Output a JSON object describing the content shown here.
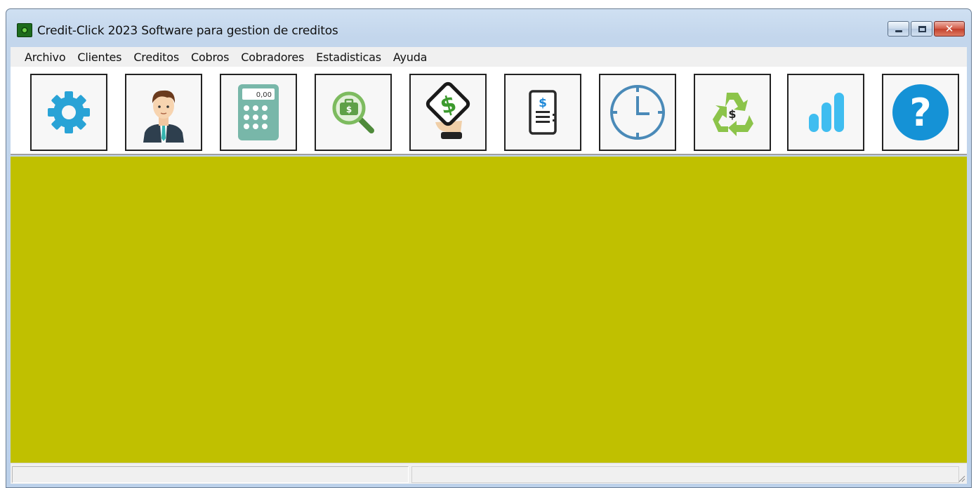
{
  "window": {
    "title": "Credit-Click 2023 Software para gestion de creditos"
  },
  "menu": [
    "Archivo",
    "Clientes",
    "Creditos",
    "Cobros",
    "Cobradores",
    "Estadisticas",
    "Ayuda"
  ],
  "toolbar": {
    "calculator_display": "0,00",
    "buttons": [
      {
        "icon": "gear-icon"
      },
      {
        "icon": "person-icon"
      },
      {
        "icon": "calculator-icon"
      },
      {
        "icon": "money-search-icon"
      },
      {
        "icon": "hand-phone-dollar-icon"
      },
      {
        "icon": "invoice-icon"
      },
      {
        "icon": "clock-icon"
      },
      {
        "icon": "recycle-dollar-icon"
      },
      {
        "icon": "bar-chart-icon"
      },
      {
        "icon": "help-icon"
      }
    ]
  },
  "colors": {
    "content_background": "#c0c000",
    "accent_blue": "#29a3d6",
    "accent_green": "#6ab04c"
  },
  "statusbar": {
    "panel1": "",
    "panel2": ""
  }
}
